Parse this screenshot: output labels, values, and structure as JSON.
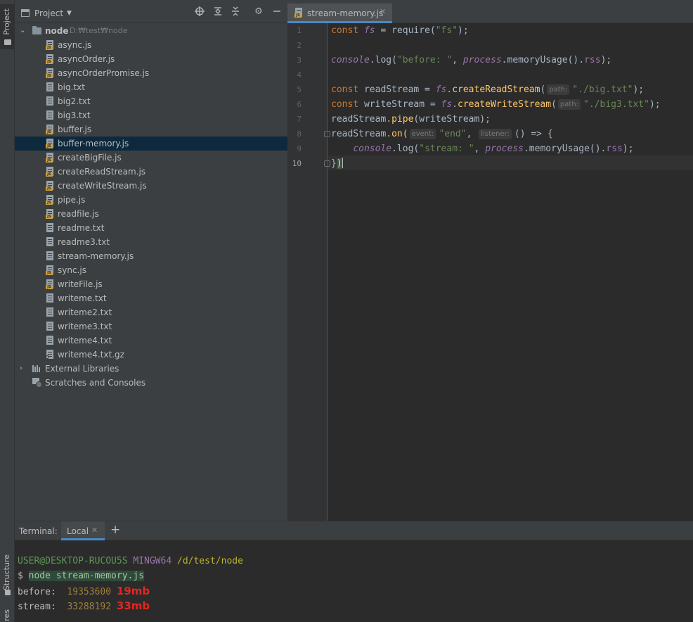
{
  "left_strip": {
    "project_tab": "Project",
    "structure_tab": "Structure",
    "bottom_tab_fragment": "res"
  },
  "project_panel": {
    "title": "Project",
    "root": {
      "name": "node",
      "path": "D:₩test₩node"
    },
    "files": [
      {
        "name": "async.js",
        "type": "js"
      },
      {
        "name": "asyncOrder.js",
        "type": "js"
      },
      {
        "name": "asyncOrderPromise.js",
        "type": "js"
      },
      {
        "name": "big.txt",
        "type": "txt"
      },
      {
        "name": "big2.txt",
        "type": "txt"
      },
      {
        "name": "big3.txt",
        "type": "txt"
      },
      {
        "name": "buffer.js",
        "type": "js"
      },
      {
        "name": "buffer-memory.js",
        "type": "js",
        "selected": true
      },
      {
        "name": "createBigFile.js",
        "type": "js"
      },
      {
        "name": "createReadStream.js",
        "type": "js"
      },
      {
        "name": "createWriteStream.js",
        "type": "js"
      },
      {
        "name": "pipe.js",
        "type": "js"
      },
      {
        "name": "readfile.js",
        "type": "js"
      },
      {
        "name": "readme.txt",
        "type": "txt"
      },
      {
        "name": "readme3.txt",
        "type": "txt"
      },
      {
        "name": "stream-memory.js",
        "type": "txt"
      },
      {
        "name": "sync.js",
        "type": "js"
      },
      {
        "name": "writeFile.js",
        "type": "js"
      },
      {
        "name": "writeme.txt",
        "type": "txt"
      },
      {
        "name": "writeme2.txt",
        "type": "txt"
      },
      {
        "name": "writeme3.txt",
        "type": "txt"
      },
      {
        "name": "writeme4.txt",
        "type": "txt"
      },
      {
        "name": "writeme4.txt.gz",
        "type": "gz"
      }
    ],
    "external_libraries": "External Libraries",
    "scratches": "Scratches and Consoles"
  },
  "editor": {
    "tab_label": "stream-memory.js",
    "line_numbers": [
      "1",
      "2",
      "3",
      "4",
      "5",
      "6",
      "7",
      "8",
      "9",
      "10"
    ],
    "hints": {
      "path": "path:",
      "event": "event:",
      "listener": "listener:"
    },
    "code": {
      "l1_kw": "const ",
      "l1_var": "fs",
      "l1_rest": " = require(",
      "l1_str": "\"fs\"",
      "l1_end": ");",
      "l3_obj": "console",
      "l3_dot": ".log(",
      "l3_str": "\"before: \"",
      "l3_comma": ", ",
      "l3_glob": "process",
      "l3_call": ".memoryUsage().",
      "l3_prop": "rss",
      "l3_end": ");",
      "l5_kw": "const ",
      "l5_var": "readStream = ",
      "l5_glob": "fs",
      "l5_dot": ".",
      "l5_fn": "createReadStream",
      "l5_open": "(",
      "l5_str": "\"./big.txt\"",
      "l5_end": ");",
      "l6_kw": "const ",
      "l6_var": "writeStream = ",
      "l6_glob": "fs",
      "l6_dot": ".",
      "l6_fn": "createWriteStream",
      "l6_open": "(",
      "l6_str": "\"./big3.txt\"",
      "l6_end": ");",
      "l7_a": "readStream.",
      "l7_fn": "pipe",
      "l7_end": "(writeStream);",
      "l8_a": "readStream.",
      "l8_fn": "on",
      "l8_open": "(",
      "l8_str": "\"end\"",
      "l8_comma": ", ",
      "l8_end": "() => {",
      "l9_indent": "    ",
      "l9_obj": "console",
      "l9_dot": ".log(",
      "l9_str": "\"stream: \"",
      "l9_comma": ", ",
      "l9_glob": "process",
      "l9_call": ".memoryUsage().",
      "l9_prop": "rss",
      "l9_end": ");",
      "l10_brace": "}",
      "l10_paren": ")"
    }
  },
  "terminal": {
    "title": "Terminal:",
    "tab_label": "Local",
    "add_label": "+",
    "prompt": {
      "user": "USER@DESKTOP-RUCOU5S",
      "host": "MINGW64",
      "path": "/d/test/node"
    },
    "command_prefix": "$ ",
    "command": "node stream-memory.js",
    "before_label": "before:  ",
    "before_value": "19353600",
    "before_note": "19mb",
    "stream_label": "stream:  ",
    "stream_value": "33288192",
    "stream_note": "33mb"
  },
  "colors": {
    "accent": "#4a88c7",
    "selection": "#0d293e",
    "annotation": "#e0281f"
  }
}
